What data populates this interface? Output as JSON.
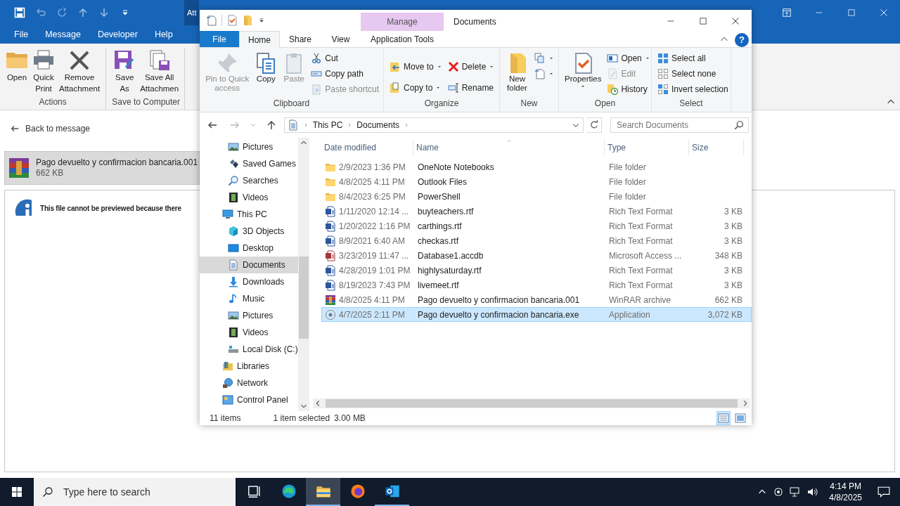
{
  "outlook": {
    "contextual_tab": "Att",
    "tabs": [
      {
        "label": "File"
      },
      {
        "label": "Message"
      },
      {
        "label": "Developer"
      },
      {
        "label": "Help"
      }
    ],
    "ribbon": [
      {
        "label": "Actions",
        "buttons": [
          {
            "label": "Open"
          },
          {
            "label": "Quick Print"
          },
          {
            "label": "Remove Attachment"
          }
        ]
      },
      {
        "label": "Save to Computer",
        "buttons": [
          {
            "label": "Save As"
          },
          {
            "label": "Save All Attachmen"
          }
        ]
      }
    ],
    "back_link": "Back to message",
    "attachment": {
      "name": "Pago devuelto y confirmacion bancaria.001",
      "size": "662 KB",
      "selected": true
    },
    "preview_message": "This file cannot be previewed because there"
  },
  "explorer": {
    "title": "Documents",
    "contextual_header": "Manage",
    "help": "?",
    "tabs": [
      {
        "label": "File",
        "kind": "file",
        "selected": false
      },
      {
        "label": "Home",
        "kind": "normal",
        "selected": true
      },
      {
        "label": "Share",
        "kind": "normal",
        "selected": false
      },
      {
        "label": "View",
        "kind": "normal",
        "selected": false
      },
      {
        "label": "Application Tools",
        "kind": "contextual",
        "selected": false
      }
    ],
    "ribbon": [
      {
        "label": "Clipboard",
        "items": [
          {
            "kind": "large",
            "label": "Pin to Quick access",
            "disabled": true,
            "dropdown": false
          },
          {
            "kind": "large",
            "label": "Copy",
            "disabled": false,
            "dropdown": false
          },
          {
            "kind": "large",
            "label": "Paste",
            "disabled": true,
            "dropdown": false
          },
          {
            "kind": "stack",
            "buttons": [
              {
                "label": "Cut",
                "disabled": false,
                "dropdown": false
              },
              {
                "label": "Copy path",
                "disabled": false,
                "dropdown": false
              },
              {
                "label": "Paste shortcut",
                "disabled": true,
                "dropdown": false
              }
            ]
          }
        ]
      },
      {
        "label": "Organize",
        "items": [
          {
            "kind": "stack",
            "buttons": [
              {
                "label": "Move to",
                "disabled": false,
                "dropdown": true
              },
              {
                "label": "Copy to",
                "disabled": false,
                "dropdown": true
              }
            ]
          },
          {
            "kind": "stack",
            "buttons": [
              {
                "label": "Delete",
                "disabled": false,
                "dropdown": true
              },
              {
                "label": "Rename",
                "disabled": false,
                "dropdown": false
              }
            ]
          }
        ]
      },
      {
        "label": "New",
        "items": [
          {
            "kind": "large",
            "label": "New folder",
            "disabled": false,
            "dropdown": false
          },
          {
            "kind": "stack",
            "buttons": [
              {
                "disabled": false,
                "dropdown": true
              },
              {
                "disabled": false,
                "dropdown": true
              }
            ]
          }
        ]
      },
      {
        "label": "Open",
        "items": [
          {
            "kind": "large",
            "label": "Properties",
            "disabled": false,
            "dropdown": true
          },
          {
            "kind": "stack",
            "buttons": [
              {
                "label": "Open",
                "disabled": false,
                "dropdown": true
              },
              {
                "label": "Edit",
                "disabled": true,
                "dropdown": false
              },
              {
                "label": "History",
                "disabled": false,
                "dropdown": false
              }
            ]
          }
        ]
      },
      {
        "label": "Select",
        "items": [
          {
            "kind": "stack",
            "buttons": [
              {
                "label": "Select all",
                "disabled": false,
                "dropdown": false
              },
              {
                "label": "Select none",
                "disabled": false,
                "dropdown": false
              },
              {
                "label": "Invert selection",
                "disabled": false,
                "dropdown": false
              }
            ]
          }
        ]
      }
    ],
    "breadcrumb": [
      "This PC",
      "Documents"
    ],
    "search": {
      "placeholder": "Search Documents"
    },
    "nav": {
      "scrolled_children": [
        {
          "label": "Pictures",
          "kind": "pictures",
          "selected": false
        },
        {
          "label": "Saved Games",
          "kind": "games",
          "selected": false
        },
        {
          "label": "Searches",
          "kind": "search",
          "selected": false
        },
        {
          "label": "Videos",
          "kind": "videos",
          "selected": false
        }
      ],
      "items": [
        {
          "label": "This PC",
          "kind": "pc",
          "selected": false,
          "children": [
            {
              "label": "3D Objects",
              "kind": "obj3d",
              "selected": false
            },
            {
              "label": "Desktop",
              "kind": "desktop",
              "selected": false
            },
            {
              "label": "Documents",
              "kind": "documents",
              "selected": true
            },
            {
              "label": "Downloads",
              "kind": "downloads",
              "selected": false
            },
            {
              "label": "Music",
              "kind": "music",
              "selected": false
            },
            {
              "label": "Pictures",
              "kind": "pictures",
              "selected": false
            },
            {
              "label": "Videos",
              "kind": "videos",
              "selected": false
            },
            {
              "label": "Local Disk (C:)",
              "kind": "disk",
              "selected": false
            }
          ]
        },
        {
          "label": "Libraries",
          "kind": "libraries",
          "selected": false
        },
        {
          "label": "Network",
          "kind": "network",
          "selected": false
        },
        {
          "label": "Control Panel",
          "kind": "control",
          "selected": false
        }
      ]
    },
    "columns": [
      "Date modified",
      "Name",
      "Type",
      "Size"
    ],
    "files": [
      {
        "date": "2/9/2023 1:36 PM",
        "name": "OneNote Notebooks",
        "type": "File folder",
        "kind": "folder",
        "selected": false
      },
      {
        "date": "4/8/2025 4:11 PM",
        "name": "Outlook Files",
        "type": "File folder",
        "kind": "folder",
        "selected": false
      },
      {
        "date": "8/4/2023 6:25 PM",
        "name": "PowerShell",
        "type": "File folder",
        "kind": "folder",
        "selected": false
      },
      {
        "date": "1/11/2020 12:14 ...",
        "name": "buyteachers.rtf",
        "type": "Rich Text Format",
        "size": "3 KB",
        "kind": "word",
        "selected": false
      },
      {
        "date": "1/20/2022 1:16 PM",
        "name": "carthings.rtf",
        "type": "Rich Text Format",
        "size": "3 KB",
        "kind": "word",
        "selected": false
      },
      {
        "date": "8/9/2021 6:40 AM",
        "name": "checkas.rtf",
        "type": "Rich Text Format",
        "size": "3 KB",
        "kind": "word",
        "selected": false
      },
      {
        "date": "3/23/2019 11:47 ...",
        "name": "Database1.accdb",
        "type": "Microsoft Access ...",
        "size": "348 KB",
        "kind": "access",
        "selected": false
      },
      {
        "date": "4/28/2019 1:01 PM",
        "name": "highlysaturday.rtf",
        "type": "Rich Text Format",
        "size": "3 KB",
        "kind": "word",
        "selected": false
      },
      {
        "date": "8/19/2023 7:43 PM",
        "name": "livemeet.rtf",
        "type": "Rich Text Format",
        "size": "3 KB",
        "kind": "word",
        "selected": false
      },
      {
        "date": "4/8/2025 4:11 PM",
        "name": "Pago devuelto y confirmacion bancaria.001",
        "type": "WinRAR archive",
        "size": "662 KB",
        "kind": "rar",
        "selected": false
      },
      {
        "date": "4/7/2025 2:11 PM",
        "name": "Pago devuelto y confirmacion bancaria.exe",
        "type": "Application",
        "size": "3,072 KB",
        "kind": "exe",
        "selected": true
      }
    ],
    "status": {
      "count": "11 items",
      "selection": "1 item selected",
      "size": "3.00 MB"
    },
    "views": [
      {
        "selected": true
      },
      {
        "selected": false
      }
    ]
  },
  "taskbar": {
    "search": {
      "placeholder": "Type here to search"
    },
    "apps": [
      {
        "kind": "taskview",
        "active": false,
        "open": false
      },
      {
        "kind": "edge",
        "active": false,
        "open": false
      },
      {
        "kind": "explorer",
        "active": true,
        "open": true
      },
      {
        "kind": "firefox",
        "active": false,
        "open": false
      },
      {
        "kind": "outlook",
        "active": false,
        "open": true
      }
    ],
    "time": "4:14 PM",
    "date": "4/8/2025"
  }
}
